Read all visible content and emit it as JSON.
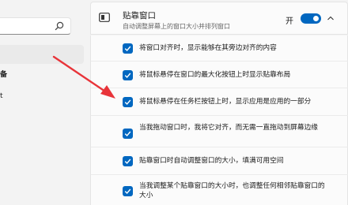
{
  "nav": {
    "search_icon": "search-icon",
    "fragments": [
      "备",
      "t"
    ]
  },
  "snap": {
    "icon": "window-icon",
    "title": "贴靠窗口",
    "description": "自动调整屏幕上的窗口大小并排列窗口",
    "toggle_label": "开",
    "toggle_on": true,
    "expand_icon": "chevron-up-icon",
    "accent_color": "#0067c0"
  },
  "options": [
    {
      "label": "将窗口对齐时，显示能够在其旁边对齐的内容",
      "checked": true
    },
    {
      "label": "将鼠标悬停在窗口的最大化按钮上时显示贴靠布局",
      "checked": true
    },
    {
      "label": "将鼠标悬停在任务栏按钮上时，显示应用是应用的一部分",
      "checked": true
    },
    {
      "label": "当我拖动窗口时，我将它对齐，而无需一直拖动到屏幕边缘",
      "checked": true
    },
    {
      "label": "贴靠窗口时自动调整窗口的大小，填满可用空间",
      "checked": true
    },
    {
      "label": "当我调整某个贴靠窗口的大小时，也调整任何相邻贴靠窗口的大小",
      "checked": true
    }
  ],
  "annotation": {
    "arrow_color": "#e8343a"
  }
}
